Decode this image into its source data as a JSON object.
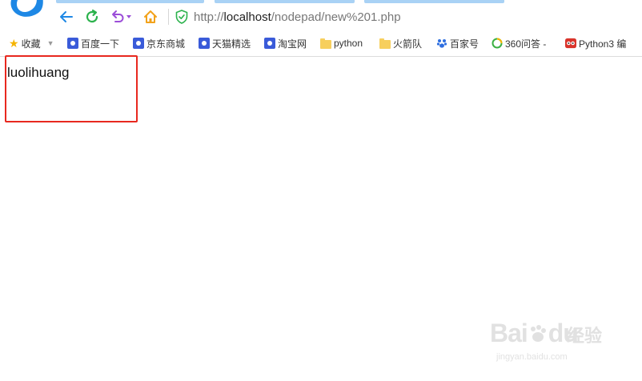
{
  "browser": {
    "url_prefix": "http://",
    "url_host": "localhost",
    "url_path": "/nodepad/new%201.php"
  },
  "bookmarks": [
    {
      "label": "收藏",
      "icon": "star-icon"
    },
    {
      "label": "百度一下",
      "icon": "baidu-paw-icon"
    },
    {
      "label": "京东商城",
      "icon": "baidu-paw-icon"
    },
    {
      "label": "天猫精选",
      "icon": "baidu-paw-icon"
    },
    {
      "label": "淘宝网",
      "icon": "baidu-paw-icon"
    },
    {
      "label": "python",
      "icon": "folder-icon"
    },
    {
      "label": "火箭队",
      "icon": "folder-icon"
    },
    {
      "label": "百家号",
      "icon": "baijiahao-icon"
    },
    {
      "label": "360问答 -",
      "icon": "360-icon"
    },
    {
      "label": "Python3 编",
      "icon": "runoob-icon"
    }
  ],
  "page": {
    "text": "luolihuang"
  },
  "watermark": {
    "brand": "Bai",
    "brand2": "du",
    "product": "经验",
    "url": "jingyan.baidu.com"
  },
  "colors": {
    "accent": "#1e88e5",
    "refresh": "#2bb24c",
    "undo": "#9b4dd8",
    "home": "#f2a21b",
    "shield": "#2bb24c",
    "highlight": "#e8281f"
  }
}
